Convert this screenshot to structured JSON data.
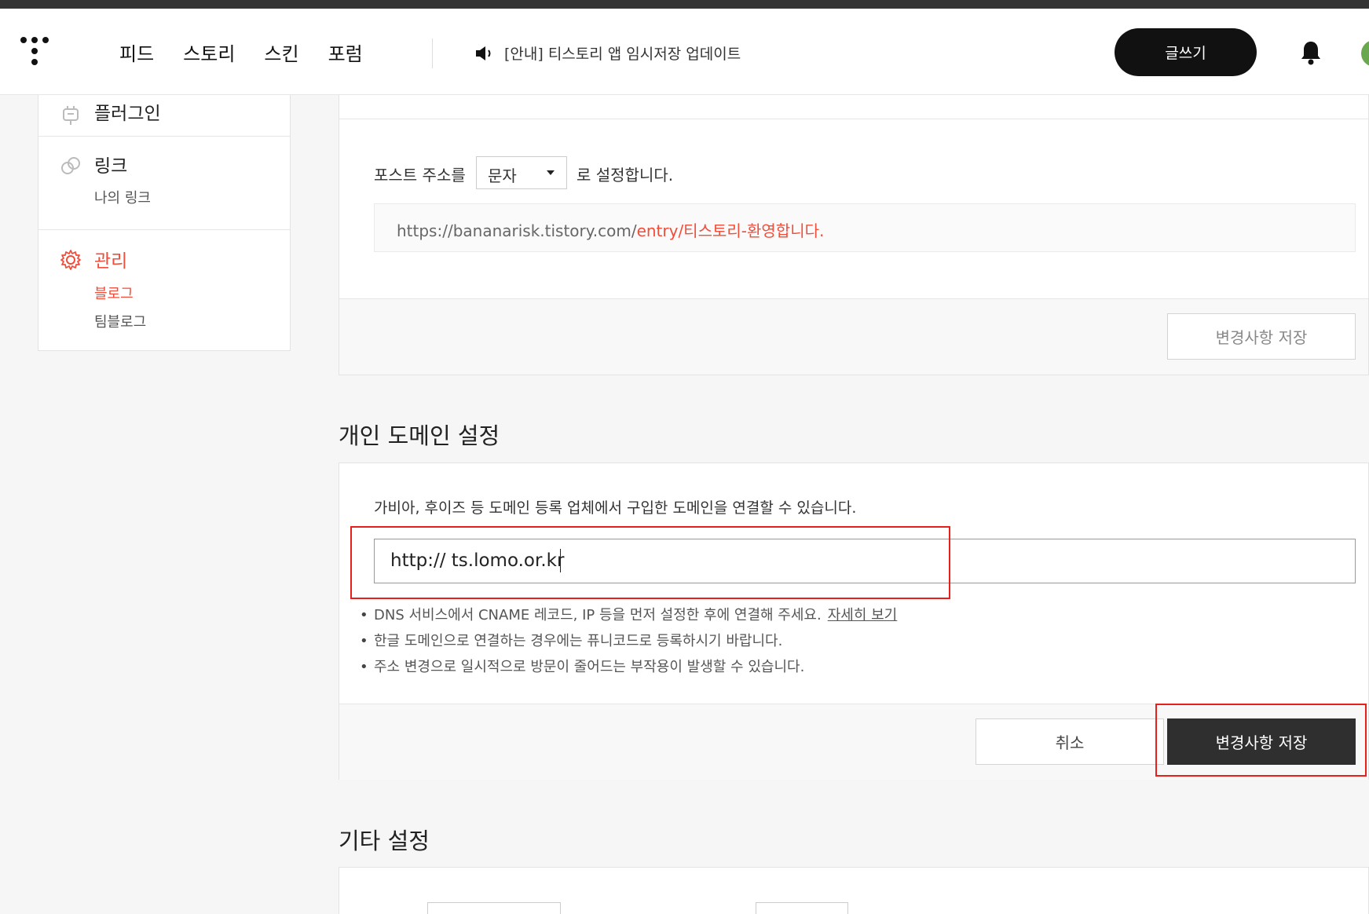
{
  "header": {
    "nav": [
      "피드",
      "스토리",
      "스킨",
      "포럼"
    ],
    "notice": "[안내] 티스토리 앱 임시저장 업데이트",
    "write_label": "글쓰기"
  },
  "sidebar": {
    "plugin": "플러그인",
    "link": {
      "title": "링크",
      "sub": "나의 링크"
    },
    "manage": {
      "title": "관리",
      "sub_active": "블로그",
      "sub": "팀블로그"
    }
  },
  "post_address": {
    "prefix": "포스트 주소를",
    "select_value": "문자",
    "suffix": "로 설정합니다.",
    "url_base": "https://bananarisk.tistory.com/",
    "url_highlight": "entry/티스토리-환영합니다.",
    "save_label": "변경사항 저장"
  },
  "domain": {
    "title": "개인 도메인 설정",
    "desc": "가비아, 후이즈 등 도메인 등록 업체에서 구입한 도메인을 연결할 수 있습니다.",
    "input_value": "http:// ts.lomo.or.kr",
    "notes": [
      "DNS 서비스에서 CNAME 레코드, IP 등을 먼저 설정한 후에 연결해 주세요.",
      "한글 도메인으로 연결하는 경우에는 퓨니코드로 등록하시기 바랍니다.",
      "주소 변경으로 일시적으로 방문이 줄어드는 부작용이 발생할 수 있습니다."
    ],
    "detail_link": "자세히 보기",
    "cancel_label": "취소",
    "save_label": "변경사항 저장"
  },
  "other": {
    "title": "기타 설정"
  },
  "colors": {
    "accent": "#f04d3a",
    "highlight_box": "#e8201c"
  }
}
